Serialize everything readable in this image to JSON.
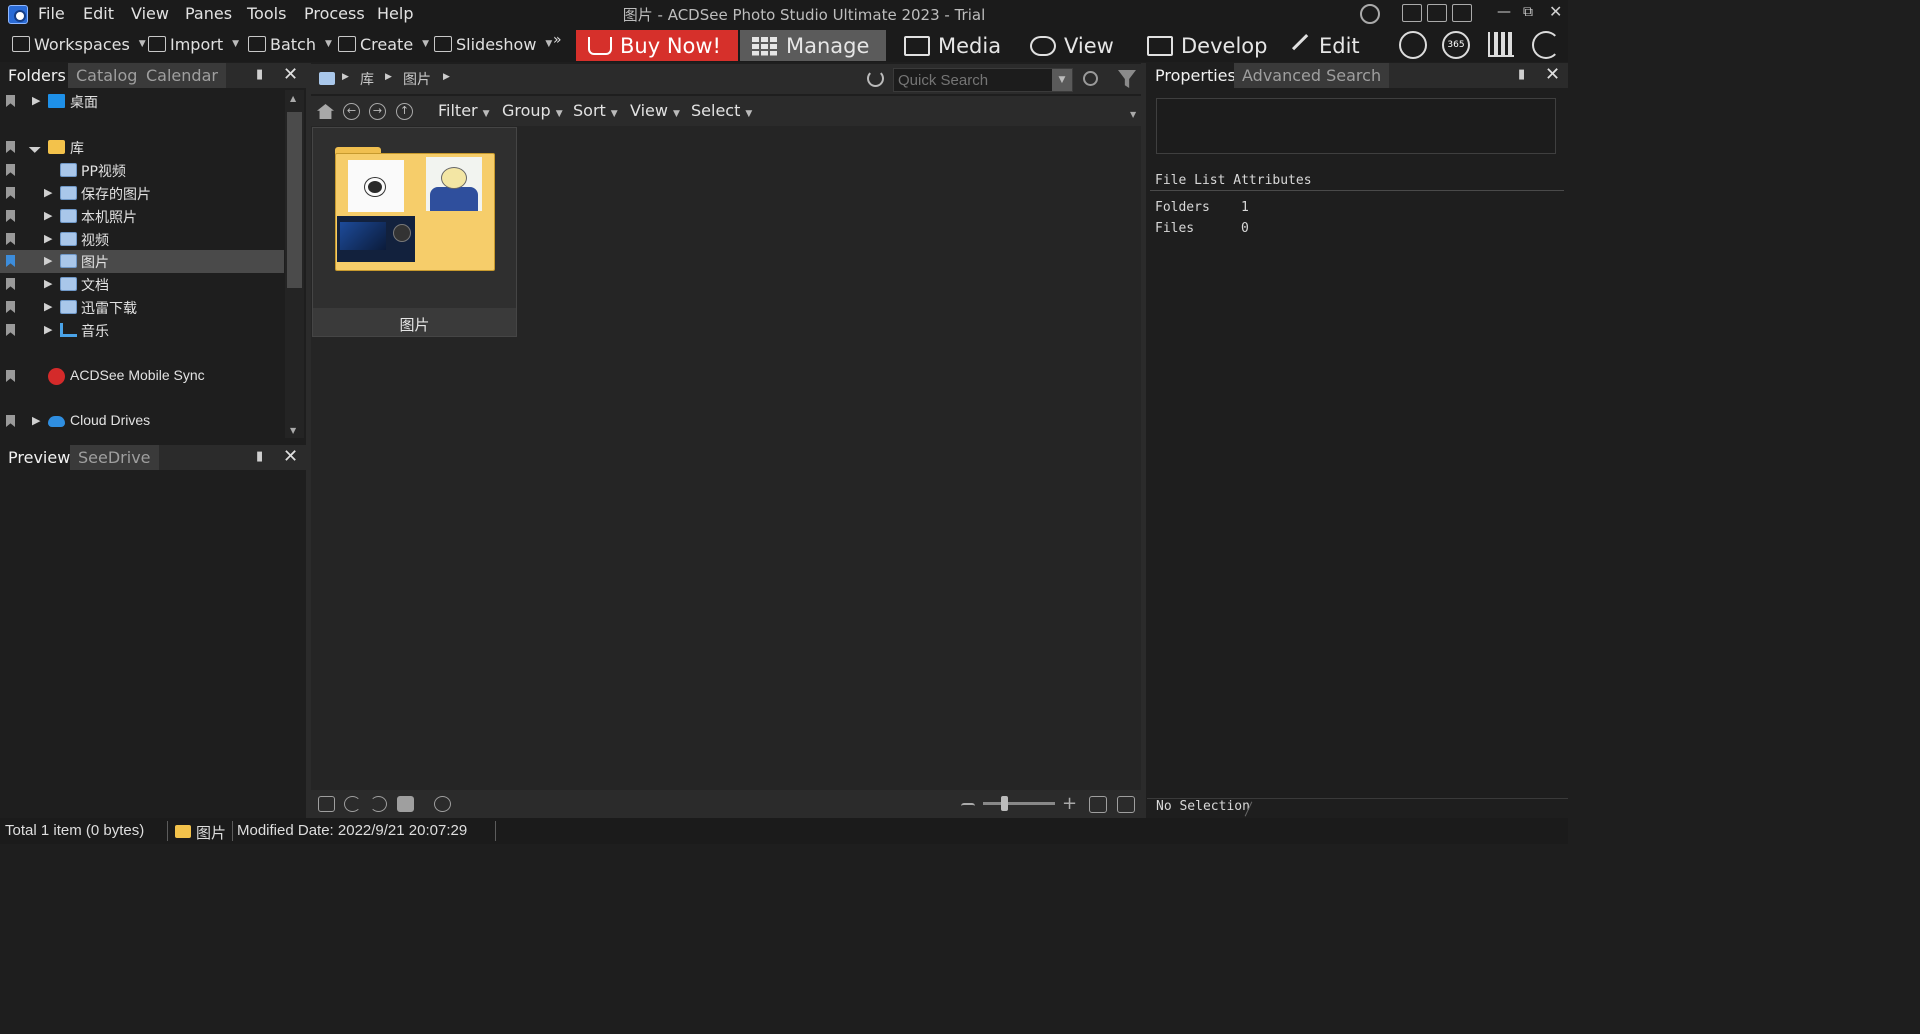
{
  "window": {
    "title": "图片 - ACDSee Photo Studio Ultimate 2023 - Trial"
  },
  "menu": [
    "File",
    "Edit",
    "View",
    "Panes",
    "Tools",
    "Process",
    "Help"
  ],
  "toolbar": {
    "workspaces": "Workspaces",
    "import": "Import",
    "batch": "Batch",
    "create": "Create",
    "slideshow": "Slideshow",
    "overflow": "»",
    "buy_now": "Buy Now!"
  },
  "modes": [
    "Manage",
    "Media",
    "View",
    "Develop",
    "Edit"
  ],
  "mode_active": "Manage",
  "mode_icons": [
    "people-icon",
    "365-icon",
    "dashboard-icon",
    "eye-refresh-icon"
  ],
  "left_tabs": [
    "Folders",
    "Catalog",
    "Calendar"
  ],
  "folder_tree": [
    {
      "label": "桌面",
      "icon": "desktop-icon",
      "level": 0,
      "expandable": true
    },
    {
      "label": "库",
      "icon": "library-folder-icon",
      "level": 0,
      "expanded": true
    },
    {
      "label": "PP视频",
      "icon": "pc-folder-icon",
      "level": 1,
      "expandable": false
    },
    {
      "label": "保存的图片",
      "icon": "pc-folder-icon",
      "level": 1,
      "expandable": true
    },
    {
      "label": "本机照片",
      "icon": "pc-folder-icon",
      "level": 1,
      "expandable": true
    },
    {
      "label": "视频",
      "icon": "pc-folder-icon",
      "level": 1,
      "expandable": true
    },
    {
      "label": "图片",
      "icon": "pc-folder-icon",
      "level": 1,
      "expandable": true,
      "selected": true
    },
    {
      "label": "文档",
      "icon": "pc-folder-icon",
      "level": 1,
      "expandable": true
    },
    {
      "label": "迅雷下载",
      "icon": "pc-folder-icon",
      "level": 1,
      "expandable": true
    },
    {
      "label": "音乐",
      "icon": "music-folder-icon",
      "level": 1,
      "expandable": true
    },
    {
      "label": "ACDSee Mobile Sync",
      "icon": "mobile-sync-icon",
      "level": 0
    },
    {
      "label": "Cloud Drives",
      "icon": "cloud-icon",
      "level": 0,
      "expandable": true
    }
  ],
  "lower_left_tabs": [
    "Preview",
    "SeeDrive"
  ],
  "breadcrumb": [
    "库",
    "图片"
  ],
  "quick_search": {
    "placeholder": "Quick Search"
  },
  "filter_bar": [
    "Filter",
    "Group",
    "Sort",
    "View",
    "Select"
  ],
  "file_items": [
    {
      "label": "图片",
      "type": "folder"
    }
  ],
  "right_tabs": [
    "Properties",
    "Advanced Search"
  ],
  "attributes": {
    "heading": "File List Attributes",
    "rows": [
      {
        "key": "Folders",
        "value": "1"
      },
      {
        "key": "Files",
        "value": "0"
      }
    ]
  },
  "selection_status": "No Selection",
  "status_bar": {
    "total": "Total 1 item  (0 bytes)",
    "folder": "图片",
    "modified": "Modified Date: 2022/9/21 20:07:29"
  },
  "colors": {
    "buy_now": "#d6302b",
    "active_mode": "#5b5b5b",
    "selected_row": "#4a4a4a",
    "folder_yellow": "#f6cd6a"
  }
}
